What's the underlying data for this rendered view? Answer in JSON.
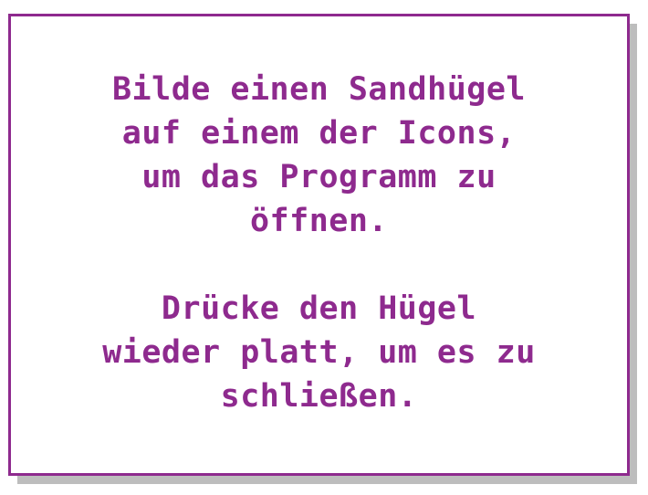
{
  "dialog": {
    "paragraph1": "Bilde einen Sandhügel\nauf einem der Icons,\num das Programm zu\nöffnen.",
    "paragraph2": "Drücke den Hügel\nwieder platt, um es zu\nschließen."
  },
  "colors": {
    "text": "#8e2a8e",
    "border": "#8e2a8e",
    "shadow": "#bdbdbd",
    "background": "#ffffff"
  }
}
